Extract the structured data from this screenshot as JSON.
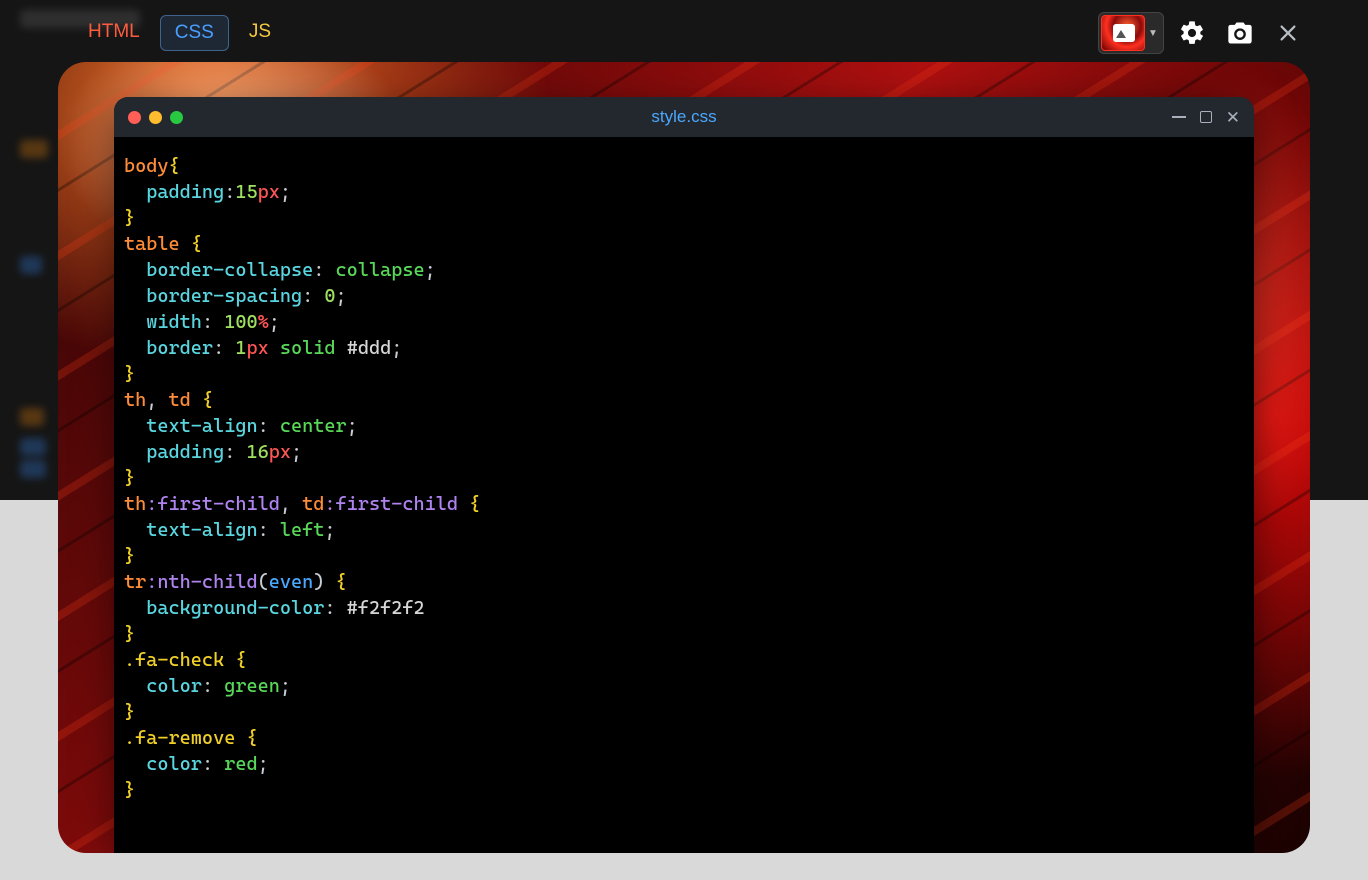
{
  "tabs": {
    "html": "HTML",
    "css": "CSS",
    "js": "JS",
    "active": "CSS"
  },
  "toolbar": {
    "bg_picker": "background-picker",
    "settings": "settings",
    "camera": "screenshot",
    "close": "close"
  },
  "window": {
    "filename": "style.css"
  },
  "code": {
    "lines": [
      {
        "tokens": [
          [
            "sel",
            "body"
          ],
          [
            "brace",
            "{"
          ]
        ]
      },
      {
        "indent": 1,
        "tokens": [
          [
            "prop",
            "padding"
          ],
          [
            "punc",
            ":"
          ],
          [
            "num",
            "15"
          ],
          [
            "unit",
            "px"
          ],
          [
            "punc",
            ";"
          ]
        ]
      },
      {
        "tokens": [
          [
            "brace",
            "}"
          ]
        ]
      },
      {
        "tokens": [
          [
            "sel",
            "table"
          ],
          [
            "space",
            " "
          ],
          [
            "brace",
            "{"
          ]
        ]
      },
      {
        "indent": 1,
        "tokens": [
          [
            "prop",
            "border-collapse"
          ],
          [
            "punc",
            ":"
          ],
          [
            "space",
            " "
          ],
          [
            "val",
            "collapse"
          ],
          [
            "punc",
            ";"
          ]
        ]
      },
      {
        "indent": 1,
        "tokens": [
          [
            "prop",
            "border-spacing"
          ],
          [
            "punc",
            ":"
          ],
          [
            "space",
            " "
          ],
          [
            "num",
            "0"
          ],
          [
            "punc",
            ";"
          ]
        ]
      },
      {
        "indent": 1,
        "tokens": [
          [
            "prop",
            "width"
          ],
          [
            "punc",
            ":"
          ],
          [
            "space",
            " "
          ],
          [
            "num",
            "100"
          ],
          [
            "unit",
            "%"
          ],
          [
            "punc",
            ";"
          ]
        ]
      },
      {
        "indent": 1,
        "tokens": [
          [
            "prop",
            "border"
          ],
          [
            "punc",
            ":"
          ],
          [
            "space",
            " "
          ],
          [
            "num",
            "1"
          ],
          [
            "unit",
            "px"
          ],
          [
            "space",
            " "
          ],
          [
            "val",
            "solid"
          ],
          [
            "space",
            " "
          ],
          [
            "hex",
            "#ddd"
          ],
          [
            "punc",
            ";"
          ]
        ]
      },
      {
        "tokens": [
          [
            "brace",
            "}"
          ]
        ]
      },
      {
        "tokens": [
          [
            "sel",
            "th"
          ],
          [
            "punc",
            ","
          ],
          [
            "space",
            " "
          ],
          [
            "sel",
            "td"
          ],
          [
            "space",
            " "
          ],
          [
            "brace",
            "{"
          ]
        ]
      },
      {
        "indent": 1,
        "tokens": [
          [
            "prop",
            "text-align"
          ],
          [
            "punc",
            ":"
          ],
          [
            "space",
            " "
          ],
          [
            "val",
            "center"
          ],
          [
            "punc",
            ";"
          ]
        ]
      },
      {
        "indent": 1,
        "tokens": [
          [
            "prop",
            "padding"
          ],
          [
            "punc",
            ":"
          ],
          [
            "space",
            " "
          ],
          [
            "num",
            "16"
          ],
          [
            "unit",
            "px"
          ],
          [
            "punc",
            ";"
          ]
        ]
      },
      {
        "tokens": [
          [
            "brace",
            "}"
          ]
        ]
      },
      {
        "tokens": [
          [
            "sel",
            "th"
          ],
          [
            "pseudo",
            ":first-child"
          ],
          [
            "punc",
            ","
          ],
          [
            "space",
            " "
          ],
          [
            "sel",
            "td"
          ],
          [
            "pseudo",
            ":first-child"
          ],
          [
            "space",
            " "
          ],
          [
            "brace",
            "{"
          ]
        ]
      },
      {
        "indent": 1,
        "tokens": [
          [
            "prop",
            "text-align"
          ],
          [
            "punc",
            ":"
          ],
          [
            "space",
            " "
          ],
          [
            "val",
            "left"
          ],
          [
            "punc",
            ";"
          ]
        ]
      },
      {
        "tokens": [
          [
            "brace",
            "}"
          ]
        ]
      },
      {
        "tokens": [
          [
            "sel",
            "tr"
          ],
          [
            "pseudo",
            ":nth-child"
          ],
          [
            "punc",
            "("
          ],
          [
            "fn",
            "even"
          ],
          [
            "punc",
            ")"
          ],
          [
            "space",
            " "
          ],
          [
            "brace",
            "{"
          ]
        ]
      },
      {
        "indent": 1,
        "tokens": [
          [
            "prop",
            "background-color"
          ],
          [
            "punc",
            ":"
          ],
          [
            "space",
            " "
          ],
          [
            "hex",
            "#f2f2f2"
          ]
        ]
      },
      {
        "tokens": [
          [
            "brace",
            "}"
          ]
        ]
      },
      {
        "tokens": [
          [
            "class",
            ".fa-check"
          ],
          [
            "space",
            " "
          ],
          [
            "brace",
            "{"
          ]
        ]
      },
      {
        "indent": 1,
        "tokens": [
          [
            "prop",
            "color"
          ],
          [
            "punc",
            ":"
          ],
          [
            "space",
            " "
          ],
          [
            "val",
            "green"
          ],
          [
            "punc",
            ";"
          ]
        ]
      },
      {
        "tokens": [
          [
            "brace",
            "}"
          ]
        ]
      },
      {
        "tokens": [
          [
            "class",
            ".fa-remove"
          ],
          [
            "space",
            " "
          ],
          [
            "brace",
            "{"
          ]
        ]
      },
      {
        "indent": 1,
        "tokens": [
          [
            "prop",
            "color"
          ],
          [
            "punc",
            ":"
          ],
          [
            "space",
            " "
          ],
          [
            "val",
            "red"
          ],
          [
            "punc",
            ";"
          ]
        ]
      },
      {
        "tokens": [
          [
            "brace",
            "}"
          ]
        ]
      }
    ]
  }
}
